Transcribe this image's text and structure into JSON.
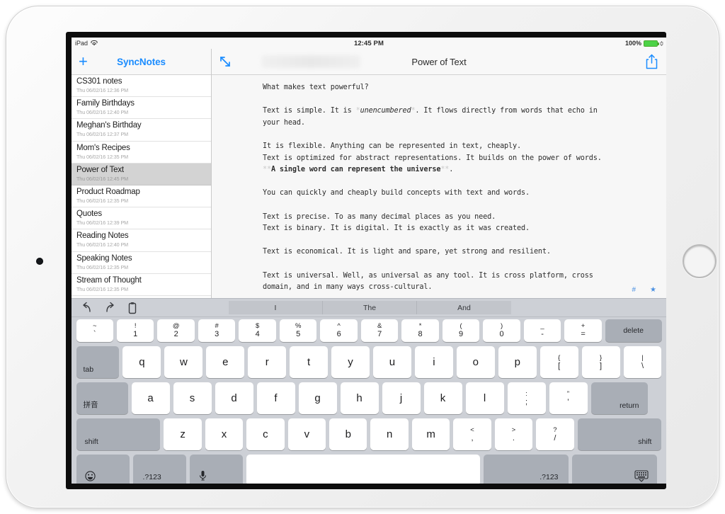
{
  "status_bar": {
    "device_label": "iPad",
    "wifi_icon": "wifi-icon",
    "time": "12:45 PM",
    "battery_percent": "100%",
    "battery_icon": "battery-full-icon",
    "charging_icon": "charging-plug-icon"
  },
  "sidebar": {
    "add_button_label": "+",
    "app_title": "SyncNotes",
    "notes": [
      {
        "title": "CS301 notes",
        "date": "Thu 06/02/16 12:36 PM",
        "selected": false
      },
      {
        "title": "Family Birthdays",
        "date": "Thu 06/02/16 12:40 PM",
        "selected": false
      },
      {
        "title": "Meghan's Birthday",
        "date": "Thu 06/02/16 12:37 PM",
        "selected": false
      },
      {
        "title": "Mom's Recipes",
        "date": "Thu 06/02/16 12:35 PM",
        "selected": false
      },
      {
        "title": "Power of Text",
        "date": "Thu 06/02/16 12:45 PM",
        "selected": true
      },
      {
        "title": "Product Roadmap",
        "date": "Thu 06/02/16 12:35 PM",
        "selected": false
      },
      {
        "title": "Quotes",
        "date": "Thu 06/02/16 12:39 PM",
        "selected": false
      },
      {
        "title": "Reading Notes",
        "date": "Thu 06/02/16 12:40 PM",
        "selected": false
      },
      {
        "title": "Speaking Notes",
        "date": "Thu 06/02/16 12:35 PM",
        "selected": false
      },
      {
        "title": "Stream of Thought",
        "date": "Thu 06/02/16 12:35 PM",
        "selected": false
      }
    ]
  },
  "editor": {
    "expand_icon": "expand-arrows-icon",
    "note_title": "Power of Text",
    "share_icon": "share-upload-icon",
    "tools": {
      "hash_icon": "#",
      "star_icon": "★"
    },
    "lines": [
      "What makes text powerful?",
      "",
      "Text is simple. It is *unencumbered*. It flows directly from words that echo in",
      "your head.",
      "",
      "It is flexible. Anything can be represented in text, cheaply.",
      "Text is optimized for abstract representations. It builds on the power of words.",
      "**A single word can represent the universe**.",
      "",
      "You can quickly and cheaply build concepts with text and words.",
      "",
      "Text is precise. To as many decimal places as you need.",
      "Text is binary. It is digital. It is exactly as it was created.",
      "",
      "Text is economical. It is light and spare, yet strong and resilient.",
      "",
      "Text is universal. Well, as universal as any tool. It is cross platform, cross",
      "domain, and in many ways cross-cultural."
    ]
  },
  "keyboard": {
    "toolbar": {
      "undo_icon": "undo-arrow-icon",
      "redo_icon": "redo-arrow-icon",
      "paste_icon": "paste-clipboard-icon"
    },
    "suggestions": [
      "I",
      "The",
      "And"
    ],
    "number_row": [
      {
        "top": "~",
        "bot": "`"
      },
      {
        "top": "!",
        "bot": "1"
      },
      {
        "top": "@",
        "bot": "2"
      },
      {
        "top": "#",
        "bot": "3"
      },
      {
        "top": "$",
        "bot": "4"
      },
      {
        "top": "%",
        "bot": "5"
      },
      {
        "top": "^",
        "bot": "6"
      },
      {
        "top": "&",
        "bot": "7"
      },
      {
        "top": "*",
        "bot": "8"
      },
      {
        "top": "(",
        "bot": "9"
      },
      {
        "top": ")",
        "bot": "0"
      },
      {
        "top": "_",
        "bot": "-"
      },
      {
        "top": "+",
        "bot": "="
      }
    ],
    "delete_label": "delete",
    "tab_label": "tab",
    "row_q": [
      "q",
      "w",
      "e",
      "r",
      "t",
      "y",
      "u",
      "i",
      "o",
      "p"
    ],
    "row_q_punct": [
      {
        "top": "{",
        "bot": "["
      },
      {
        "top": "}",
        "bot": "]"
      },
      {
        "top": "|",
        "bot": "\\"
      }
    ],
    "ime_label": "拼音",
    "row_a": [
      "a",
      "s",
      "d",
      "f",
      "g",
      "h",
      "j",
      "k",
      "l"
    ],
    "row_a_punct": [
      {
        "top": ":",
        "bot": ";"
      },
      {
        "top": "”",
        "bot": "’"
      }
    ],
    "return_label": "return",
    "shift_left_label": "shift",
    "row_z": [
      "z",
      "x",
      "c",
      "v",
      "b",
      "n",
      "m"
    ],
    "row_z_punct": [
      {
        "top": "<",
        "bot": ","
      },
      {
        "top": ">",
        "bot": "."
      },
      {
        "top": "?",
        "bot": "/"
      }
    ],
    "shift_right_label": "shift",
    "emoji_icon": "emoji-smiley-icon",
    "numeric_left_label": ".?123",
    "mic_icon": "microphone-icon",
    "space_label": "",
    "numeric_right_label": ".?123",
    "dismiss_keyboard_icon": "hide-keyboard-icon"
  },
  "colors": {
    "accent_blue": "#1a8cff",
    "tool_blue": "#4a90e2",
    "keyboard_bg": "#cdd0d6",
    "key_dark": "#a9aeb6",
    "selected_row": "#d3d3d3",
    "battery_green": "#4cd246"
  }
}
